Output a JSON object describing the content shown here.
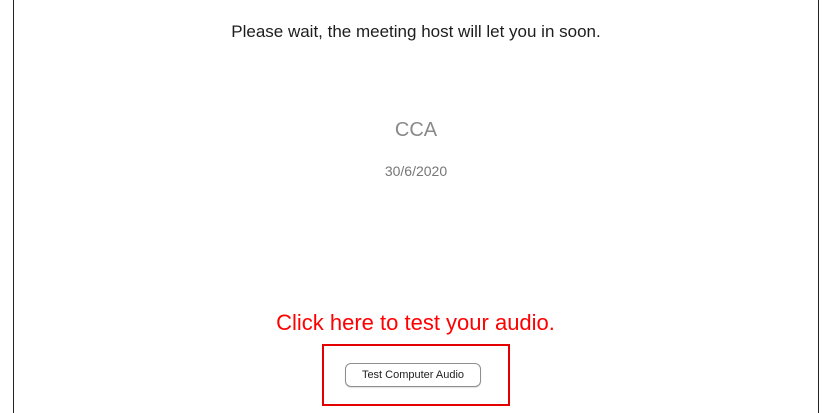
{
  "window": {
    "wait_message": "Please wait, the meeting host will let you in soon.",
    "meeting_title": "CCA",
    "meeting_date": "30/6/2020",
    "test_audio_button_label": "Test Computer Audio"
  },
  "annotation": {
    "instruction": "Click here to test your audio.",
    "color": "#ff0000"
  }
}
